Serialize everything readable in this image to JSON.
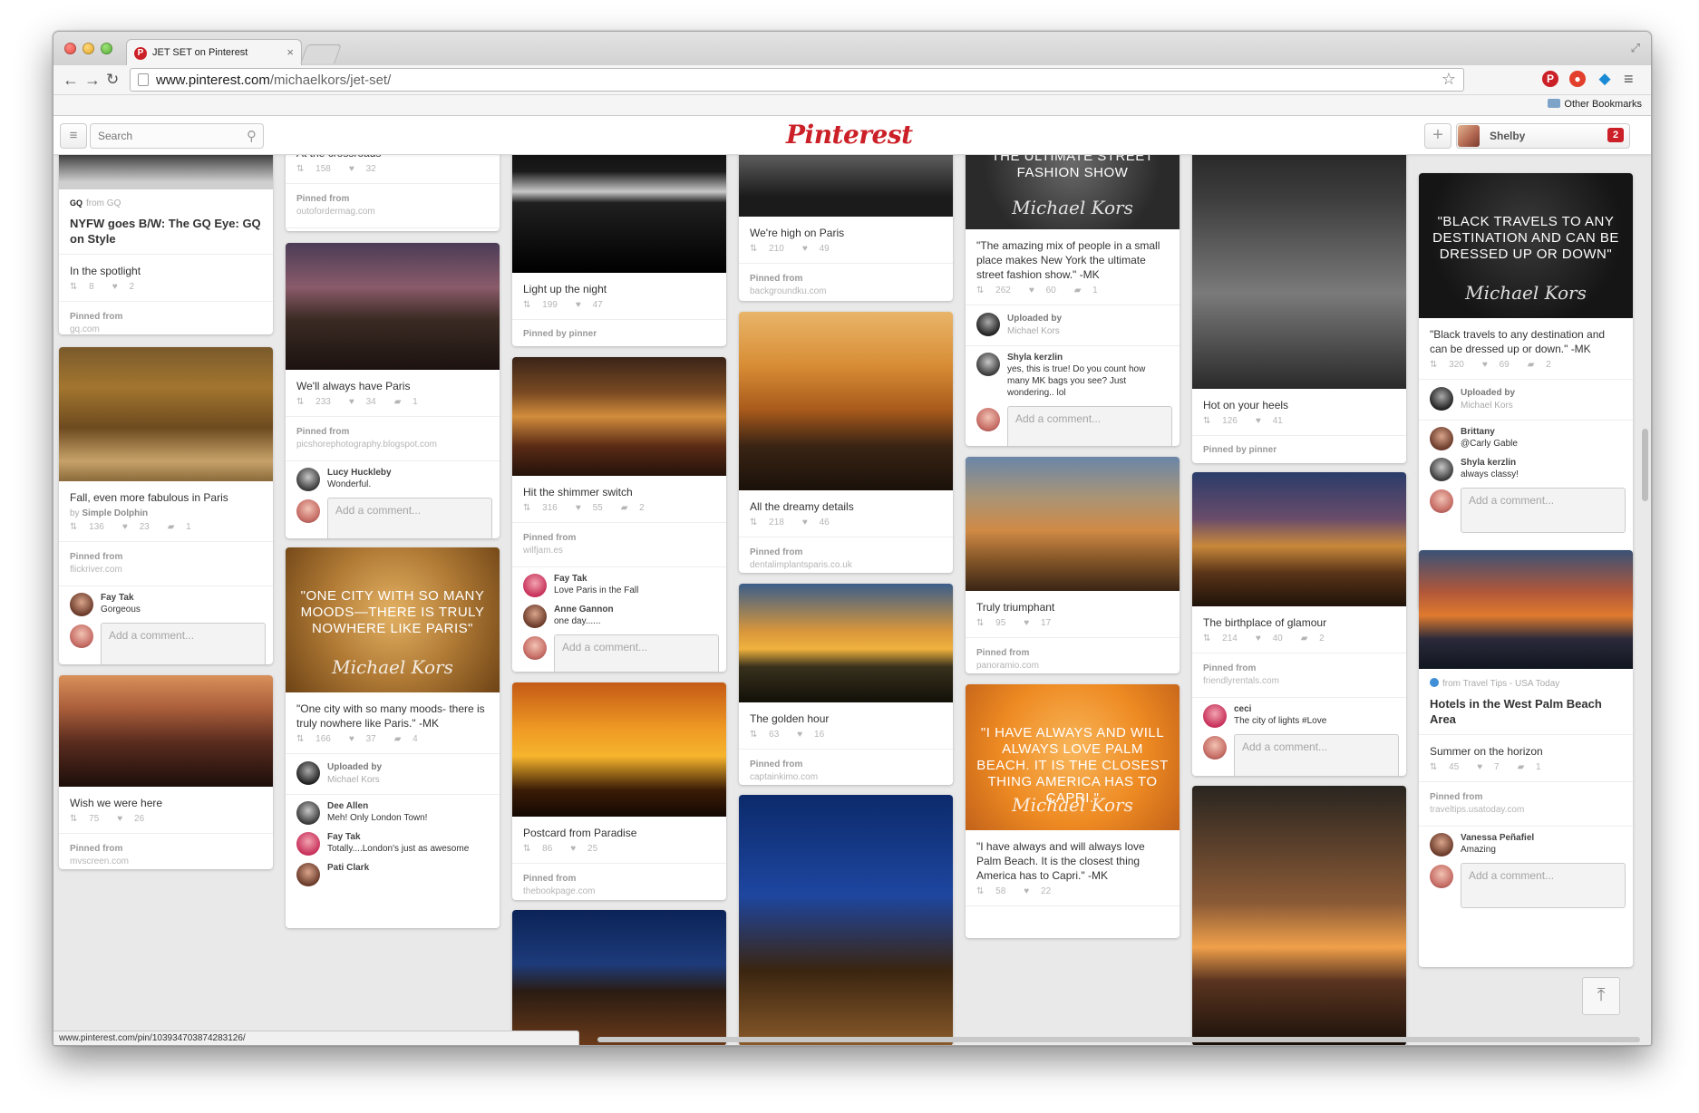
{
  "browser": {
    "tab_title": "JET SET on Pinterest",
    "tab_close": "×",
    "url_host": "www.pinterest.com",
    "url_path": "/michaelkors/jet-set/",
    "other_bookmarks": "Other Bookmarks",
    "status_url": "www.pinterest.com/pin/103934703874283126/",
    "icons": [
      "back-arrow-icon",
      "forward-arrow-icon",
      "reload-icon",
      "star-icon",
      "pinterest-extension-icon",
      "adblock-icon",
      "gem-icon",
      "menu-icon",
      "folder-icon",
      "resize-icon"
    ]
  },
  "header": {
    "search_placeholder": "Search",
    "logo": "Pinterest",
    "add_label": "+",
    "user_name": "Shelby",
    "notifications": "2"
  },
  "columns": [
    [
      {
        "image": {
          "bg": "linear-gradient(#3a3a3a,#111 40%,#cfcfcf 90%)"
        },
        "source": "from GQ",
        "headline": "NYFW goes B/W: The GQ Eye: GQ on Style",
        "desc": "In the spotlight",
        "repins": "8",
        "likes": "2",
        "pinned_from": "gq.com"
      },
      {
        "image": {
          "bg": "linear-gradient(#7a5a2c,#a3762f 30%,#6d4a1f 60%,#c7a36a 85%,#8a6a3a)"
        },
        "desc": "Fall, even more fabulous in Paris",
        "credit": "Simple Dolphin",
        "repins": "136",
        "likes": "23",
        "comments": "1",
        "pinned_from": "flickriver.com",
        "comment_list": [
          {
            "name": "Fay Tak",
            "text": "Gorgeous"
          }
        ],
        "add_comment": true
      },
      {
        "image": {
          "bg": "linear-gradient(#d9905a,#a95e3a 30%,#5a2c1e 60%,#1c0e0a)"
        },
        "desc": "Wish we were here",
        "repins": "75",
        "likes": "26",
        "pinned_from": "mvscreen.com"
      }
    ],
    [
      {
        "desc": "At the crossroads",
        "repins": "158",
        "likes": "32",
        "pinned_from": "outofordermag.com"
      },
      {
        "image": {
          "bg": "linear-gradient(#4b3c56,#8a5b6a 35%,#3b2b24 60%,#1c1210)"
        },
        "desc": "We'll always have Paris",
        "repins": "233",
        "likes": "34",
        "comments": "1",
        "pinned_from": "picshorephotography.blogspot.com",
        "comment_list": [
          {
            "name": "Lucy Huckleby",
            "text": "Wonderful."
          }
        ],
        "add_comment": true
      },
      {
        "image": {
          "bg": "radial-gradient(circle at 50% 45%,#e3b163,#b07a35 50%,#6d4315)"
        },
        "quote": "\"One city with so many moods—there is truly nowhere like Paris\"",
        "desc": "\"One city with so many moods- there is truly nowhere like Paris.\" -MK",
        "repins": "166",
        "likes": "37",
        "comments": "4",
        "uploaded_by": "Michael Kors",
        "comment_list": [
          {
            "name": "Dee Allen",
            "text": "Meh! Only London Town!"
          },
          {
            "name": "Fay Tak",
            "text": "Totally....London's just as awesome"
          },
          {
            "name": "Pati Clark",
            "text": ""
          }
        ]
      }
    ],
    [
      {
        "image": {
          "bg": "linear-gradient(#050505,#1a1a1a 35%,#c9c9c9 48%,#202020 55%,#000)"
        },
        "desc": "Light up the night",
        "repins": "199",
        "likes": "47",
        "pinned_by": "Pinned by pinner"
      },
      {
        "image": {
          "bg": "linear-gradient(#3a2418,#7a4a22 30%,#d28d3c 50%,#5a2b15 75%,#24120a)"
        },
        "desc": "Hit the shimmer switch",
        "repins": "316",
        "likes": "55",
        "comments": "2",
        "pinned_from": "wilfjam.es",
        "comment_list": [
          {
            "name": "Fay Tak",
            "text": "Love Paris in the Fall"
          },
          {
            "name": "Anne Gannon",
            "text": "one day......"
          }
        ],
        "add_comment": true
      },
      {
        "image": {
          "bg": "linear-gradient(#c45a15,#ef9a24 35%,#f6b42c 55%,#3b1c06 80%,#140802)"
        },
        "desc": "Postcard from Paradise",
        "repins": "86",
        "likes": "25",
        "pinned_from": "thebookpage.com"
      },
      {
        "image": {
          "bg": "linear-gradient(#0b2357,#1d3b7a 40%,#2a1c12 60%,#6b3a1a)"
        }
      }
    ],
    [
      {
        "image": {
          "bg": "linear-gradient(#0d0d0d,#5a5a5a 40%,#1b1b1b 80%)"
        },
        "desc": "We're high on Paris",
        "repins": "210",
        "likes": "49",
        "pinned_from": "backgroundku.com"
      },
      {
        "image": {
          "bg": "linear-gradient(#e9b56a,#d88d35 30%,#a85a1b 55%,#3a2414 75%,#1a110a)"
        },
        "desc": "All the dreamy details",
        "repins": "218",
        "likes": "46",
        "pinned_from": "dentalimplantsparis.co.uk"
      },
      {
        "image": {
          "bg": "linear-gradient(#3b5e8a,#d8963b 40%,#f0b23e 55%,#38301c 70%,#121008)"
        },
        "desc": "The golden hour",
        "repins": "63",
        "likes": "16",
        "pinned_from": "captainkimo.com"
      },
      {
        "image": {
          "bg": "linear-gradient(#0c2a6b,#1e46a0 40%,#3a2510 70%,#8a5a2a)"
        }
      }
    ],
    [
      {
        "image": {
          "bg": "radial-gradient(circle at 50% 40%,#6a6a6a,#2a2a2a 70%)"
        },
        "quote": "The ultimate street fashion show",
        "desc": "\"The amazing mix of people in a small place makes New York the ultimate street fashion show.\" -MK",
        "repins": "262",
        "likes": "60",
        "comments": "1",
        "uploaded_by": "Michael Kors",
        "comment_list": [
          {
            "name": "Shyla kerzlin",
            "text": "yes, this is true! Do you count how many MK bags you see? Just wondering.. lol"
          }
        ],
        "add_comment": true
      },
      {
        "image": {
          "bg": "linear-gradient(#6a86a8,#a99476 30%,#d08a45 55%,#8a5a2a 75%,#3a2516)"
        },
        "desc": "Truly triumphant",
        "repins": "95",
        "likes": "17",
        "pinned_from": "panoramio.com"
      },
      {
        "image": {
          "bg": "radial-gradient(circle at 50% 45%,#f8b65a,#ee8a22 55%,#c2621a)"
        },
        "quote": "\"I have always and will always love Palm Beach. It is the closest thing America has to Capri.\"",
        "desc": "\"I have always and will always love Palm Beach. It is the closest thing America has to Capri.\" -MK",
        "repins": "58",
        "likes": "22"
      }
    ],
    [
      {
        "image": {
          "bg": "linear-gradient(#1a1a1a,#3d3d3d 30%,#7a7a7a 65%,#2a2a2a)"
        },
        "desc": "Hot on your heels",
        "repins": "126",
        "likes": "41",
        "pinned_by": "Pinned by pinner"
      },
      {
        "image": {
          "bg": "linear-gradient(#2a3c6a,#6a4c6a 35%,#c8883a 55%,#5a3418 75%,#1f1209)"
        },
        "desc": "The birthplace of glamour",
        "repins": "214",
        "likes": "40",
        "comments": "2",
        "pinned_from": "friendlyrentals.com",
        "comment_list": [
          {
            "name": "ceci",
            "text": "The city of lights #Love"
          }
        ],
        "add_comment": true
      },
      {
        "image": {
          "bg": "linear-gradient(#2a2520,#8a5a36 45%,#f0a04a 62%,#5a3420 75%,#1a100a)"
        }
      }
    ],
    [
      {
        "image": {
          "bg": "radial-gradient(circle at 50% 40%,#3a3a3a,#151515 70%)"
        },
        "quote": "\"Black travels to any destination and can be dressed up or down\"",
        "desc": "\"Black travels to any destination and can be dressed up or down.\" -MK",
        "repins": "320",
        "likes": "69",
        "comments": "2",
        "uploaded_by": "Michael Kors",
        "comment_list": [
          {
            "name": "Brittany",
            "text": "@Carly Gable"
          },
          {
            "name": "Shyla kerzlin",
            "text": "always classy!"
          }
        ],
        "add_comment": true
      },
      {
        "image": {
          "bg": "linear-gradient(#3a5276,#b0573a 35%,#e07a2e 55%,#2a2a3a 75%,#121620)"
        },
        "source": "from Travel Tips - USA Today",
        "headline": "Hotels in the West Palm Beach Area",
        "desc": "Summer on the horizon",
        "repins": "45",
        "likes": "7",
        "comments": "1",
        "pinned_from": "traveltips.usatoday.com",
        "comment_list": [
          {
            "name": "Vanessa Peñafiel",
            "text": "Amazing"
          }
        ],
        "add_comment": true
      }
    ]
  ],
  "labels": {
    "pinned_from": "Pinned from",
    "uploaded_by": "Uploaded by",
    "by_prefix": "by",
    "add_comment_placeholder": "Add a comment...",
    "signature": "Michael Kors",
    "scroll_top": "⤒"
  }
}
